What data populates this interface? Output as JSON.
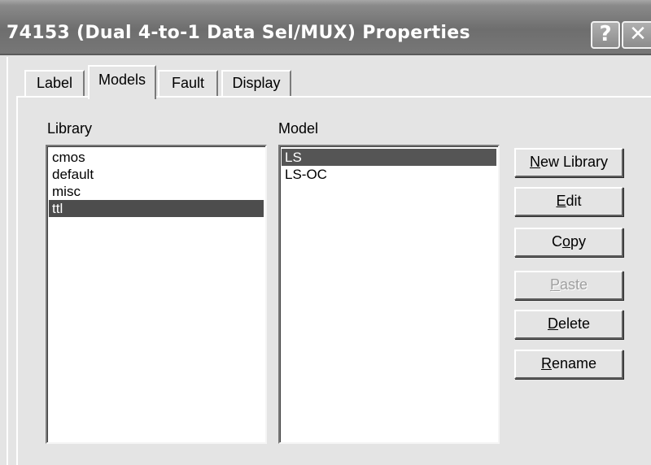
{
  "window": {
    "title": "74153 (Dual 4-to-1 Data Sel/MUX) Properties",
    "help_glyph": "?",
    "close_glyph": "✕"
  },
  "tabs": [
    {
      "label": "Label",
      "active": false
    },
    {
      "label": "Models",
      "active": true
    },
    {
      "label": "Fault",
      "active": false
    },
    {
      "label": "Display",
      "active": false
    }
  ],
  "library": {
    "label": "Library",
    "items": [
      "cmos",
      "default",
      "misc",
      "ttl"
    ],
    "selected": "ttl"
  },
  "model": {
    "label": "Model",
    "items": [
      "LS",
      "LS-OC"
    ],
    "selected": "LS"
  },
  "buttons": {
    "new_library": {
      "mnemonic": "N",
      "rest": "ew Library"
    },
    "edit": {
      "mnemonic": "E",
      "rest": "dit"
    },
    "copy": {
      "pre": "C",
      "mnemonic": "o",
      "rest": "py"
    },
    "paste": {
      "mnemonic": "P",
      "rest": "aste",
      "disabled": true
    },
    "delete": {
      "mnemonic": "D",
      "rest": "elete"
    },
    "rename": {
      "mnemonic": "R",
      "rest": "ename"
    }
  },
  "colors": {
    "title_bar": "#7a7a7a",
    "selection": "#4d4d4d",
    "face": "#e4e4e4"
  }
}
